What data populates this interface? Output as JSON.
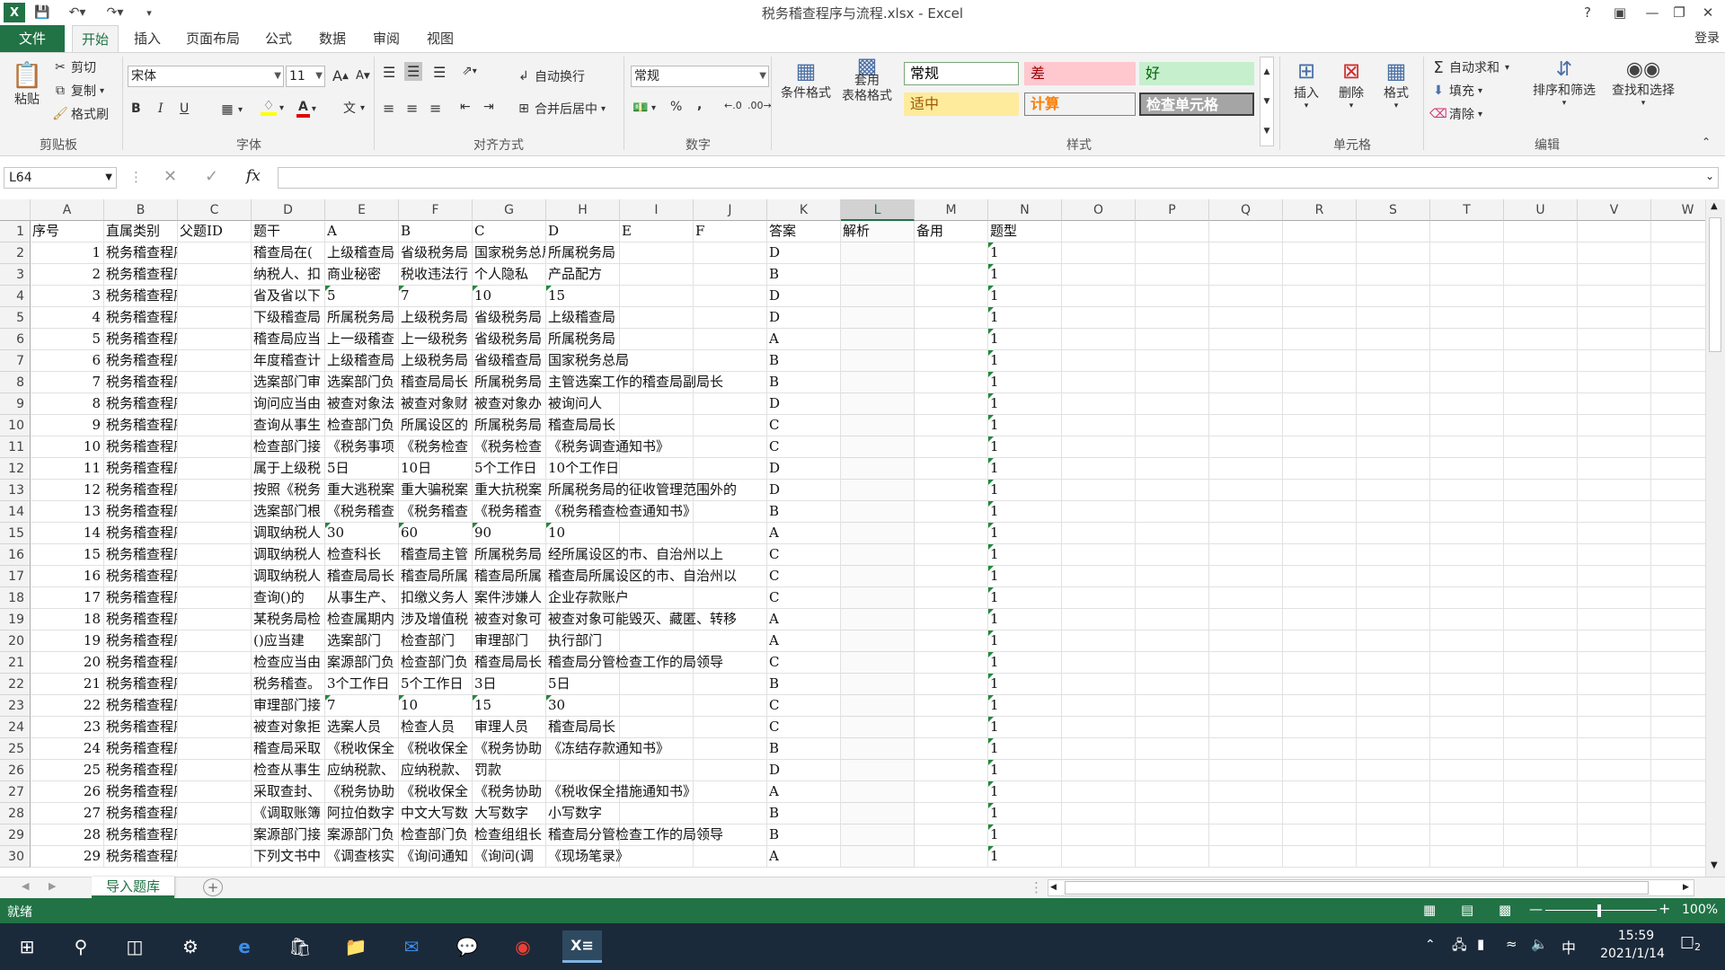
{
  "titlebar": {
    "title": "税务稽查程序与流程.xlsx - Excel",
    "app_icon": "excel-icon",
    "help": "?",
    "login": "登录"
  },
  "tabs": [
    "文件",
    "开始",
    "插入",
    "页面布局",
    "公式",
    "数据",
    "审阅",
    "视图"
  ],
  "active_tab": "开始",
  "ribbon": {
    "clipboard": {
      "paste": "粘贴",
      "cut": "剪切",
      "copy": "复制",
      "format_painter": "格式刷",
      "label": "剪贴板"
    },
    "font": {
      "name": "宋体",
      "size": "11",
      "label": "字体",
      "bold": "B",
      "italic": "I",
      "underline": "U",
      "grow": "A",
      "shrink": "A",
      "font_color": "A"
    },
    "alignment": {
      "wrap": "自动换行",
      "merge": "合并后居中",
      "label": "对齐方式"
    },
    "number": {
      "format": "常规",
      "percent": "%",
      "comma": ",",
      "label": "数字"
    },
    "styles": {
      "conditional": "条件格式",
      "table": "套用\n表格格式",
      "cells": [
        {
          "text": "常规",
          "bg": "#ffffff",
          "fg": "#000000",
          "border": "#7aa57a"
        },
        {
          "text": "差",
          "bg": "#ffc7ce",
          "fg": "#9c0006",
          "border": "#ffc7ce"
        },
        {
          "text": "好",
          "bg": "#c6efce",
          "fg": "#006100",
          "border": "#c6efce"
        },
        {
          "text": "适中",
          "bg": "#ffeb9c",
          "fg": "#9c5700",
          "border": "#ffeb9c"
        },
        {
          "text": "计算",
          "bg": "#f2f2f2",
          "fg": "#fa7d00",
          "border": "#7f7f7f"
        },
        {
          "text": "检查单元格",
          "bg": "#a5a5a5",
          "fg": "#ffffff",
          "border": "#3f3f3f"
        }
      ],
      "label": "样式"
    },
    "cells_group": {
      "insert": "插入",
      "delete": "删除",
      "format": "格式",
      "label": "单元格"
    },
    "editing": {
      "autosum": "自动求和",
      "fill": "填充",
      "clear": "清除",
      "sort": "排序和筛选",
      "find": "查找和选择",
      "label": "编辑"
    }
  },
  "formula_bar": {
    "name_box": "L64",
    "fx": "fx",
    "value": ""
  },
  "columns": [
    "A",
    "B",
    "C",
    "D",
    "E",
    "F",
    "G",
    "H",
    "I",
    "J",
    "K",
    "L",
    "M",
    "N",
    "O",
    "P",
    "Q",
    "R",
    "S",
    "T",
    "U",
    "V",
    "W"
  ],
  "selected_column": "L",
  "rows": [
    {
      "r": "1",
      "cells": {
        "A": "序号",
        "B": "直属类别",
        "C": "父题ID",
        "D": "题干",
        "E": "A",
        "F": "B",
        "G": "C",
        "H": "D",
        "I": "E",
        "J": "F",
        "K": "答案",
        "L": "解析",
        "M": "备用",
        "N": "题型"
      }
    },
    {
      "r": "2",
      "cells": {
        "A": "1",
        "B": "税务稽查程序与流程",
        "D": "稽查局在(",
        "E": "上级稽查局",
        "F": "省级税务局",
        "G": "国家税务总局",
        "H": "所属税务局",
        "K": "D",
        "N": "1"
      }
    },
    {
      "r": "3",
      "cells": {
        "A": "2",
        "B": "税务稽查程序与流程",
        "D": "纳税人、扣",
        "E": "商业秘密",
        "F": "税收违法行",
        "G": "个人隐私",
        "H": "产品配方",
        "K": "B",
        "N": "1"
      }
    },
    {
      "r": "4",
      "cells": {
        "A": "3",
        "B": "税务稽查程序与流程",
        "D": "省及省以下",
        "E": "5",
        "F": "7",
        "G": "10",
        "H": "15",
        "K": "D",
        "N": "1"
      }
    },
    {
      "r": "5",
      "cells": {
        "A": "4",
        "B": "税务稽查程序与流程",
        "D": "下级稽查局",
        "E": "所属税务局",
        "F": "上级税务局",
        "G": "省级税务局",
        "H": "上级稽查局",
        "K": "D",
        "N": "1"
      }
    },
    {
      "r": "6",
      "cells": {
        "A": "5",
        "B": "税务稽查程序与流程",
        "D": "稽查局应当",
        "E": "上一级稽查",
        "F": "上一级税务",
        "G": "省级税务局",
        "H": "所属税务局",
        "K": "A",
        "N": "1"
      }
    },
    {
      "r": "7",
      "cells": {
        "A": "6",
        "B": "税务稽查程序与流程",
        "D": "年度稽查计",
        "E": "上级稽查局",
        "F": "上级税务局",
        "G": "省级稽查局",
        "H": "国家税务总局",
        "K": "B",
        "N": "1"
      }
    },
    {
      "r": "8",
      "cells": {
        "A": "7",
        "B": "税务稽查程序与流程",
        "D": "选案部门审",
        "E": "选案部门负",
        "F": "稽查局局长",
        "G": "所属税务局",
        "H": "主管选案工作的稽查局副局长",
        "K": "B",
        "N": "1"
      }
    },
    {
      "r": "9",
      "cells": {
        "A": "8",
        "B": "税务稽查程序与流程",
        "D": "询问应当由",
        "E": "被查对象法",
        "F": "被查对象财",
        "G": "被查对象办",
        "H": "被询问人",
        "K": "D",
        "N": "1"
      }
    },
    {
      "r": "10",
      "cells": {
        "A": "9",
        "B": "税务稽查程序与流程",
        "D": "查询从事生",
        "E": "检查部门负",
        "F": "所属设区的",
        "G": "所属税务局",
        "H": "稽查局局长",
        "K": "C",
        "N": "1"
      }
    },
    {
      "r": "11",
      "cells": {
        "A": "10",
        "B": "税务稽查程序与流程",
        "D": "检查部门接",
        "E": "《税务事项",
        "F": "《税务检查",
        "G": "《税务检查",
        "H": "《税务调查通知书》",
        "K": "C",
        "N": "1"
      }
    },
    {
      "r": "12",
      "cells": {
        "A": "11",
        "B": "税务稽查程序与流程",
        "D": "属于上级税",
        "E": "5日",
        "F": "10日",
        "G": "5个工作日",
        "H": "10个工作日",
        "K": "D",
        "N": "1"
      }
    },
    {
      "r": "13",
      "cells": {
        "A": "12",
        "B": "税务稽查程序与流程",
        "D": "按照《税务",
        "E": "重大逃税案",
        "F": "重大骗税案",
        "G": "重大抗税案",
        "H": "所属税务局的征收管理范围外的",
        "K": "D",
        "N": "1"
      }
    },
    {
      "r": "14",
      "cells": {
        "A": "13",
        "B": "税务稽查程序与流程",
        "D": "选案部门根",
        "E": "《税务稽查",
        "F": "《税务稽查",
        "G": "《税务稽查",
        "H": "《税务稽查检查通知书》",
        "K": "B",
        "N": "1"
      }
    },
    {
      "r": "15",
      "cells": {
        "A": "14",
        "B": "税务稽查程序与流程",
        "D": "调取纳税人",
        "E": "30",
        "F": "60",
        "G": "90",
        "H": "10",
        "K": "A",
        "N": "1"
      }
    },
    {
      "r": "16",
      "cells": {
        "A": "15",
        "B": "税务稽查程序与流程",
        "D": "调取纳税人",
        "E": "检查科长",
        "F": "稽查局主管",
        "G": "所属税务局",
        "H": "经所属设区的市、自治州以上",
        "K": "C",
        "N": "1"
      }
    },
    {
      "r": "17",
      "cells": {
        "A": "16",
        "B": "税务稽查程序与流程",
        "D": "调取纳税人",
        "E": "稽查局局长",
        "F": "稽查局所属",
        "G": "稽查局所属",
        "H": "稽查局所属设区的市、自治州以",
        "K": "C",
        "N": "1"
      }
    },
    {
      "r": "18",
      "cells": {
        "A": "17",
        "B": "税务稽查程序与流程",
        "D": "查询()的",
        "E": "从事生产、",
        "F": "扣缴义务人",
        "G": "案件涉嫌人",
        "H": "企业存款账户",
        "K": "C",
        "N": "1"
      }
    },
    {
      "r": "19",
      "cells": {
        "A": "18",
        "B": "税务稽查程序与流程",
        "D": "某税务局检",
        "E": "检查属期内",
        "F": "涉及增值税",
        "G": "被查对象可",
        "H": "被查对象可能毁灭、藏匿、转移",
        "K": "A",
        "N": "1"
      }
    },
    {
      "r": "20",
      "cells": {
        "A": "19",
        "B": "税务稽查程序与流程",
        "D": "()应当建",
        "E": "选案部门",
        "F": "检查部门",
        "G": "审理部门",
        "H": "执行部门",
        "K": "A",
        "N": "1"
      }
    },
    {
      "r": "21",
      "cells": {
        "A": "20",
        "B": "税务稽查程序与流程",
        "D": "检查应当由",
        "E": "案源部门负",
        "F": "检查部门负",
        "G": "稽查局局长",
        "H": "稽查局分管检查工作的局领导",
        "K": "C",
        "N": "1"
      }
    },
    {
      "r": "22",
      "cells": {
        "A": "21",
        "B": "税务稽查程序与流程",
        "D": "税务稽查。",
        "E": "3个工作日",
        "F": "5个工作日",
        "G": "3日",
        "H": "5日",
        "K": "B",
        "N": "1"
      }
    },
    {
      "r": "23",
      "cells": {
        "A": "22",
        "B": "税务稽查程序与流程",
        "D": "审理部门接",
        "E": "7",
        "F": "10",
        "G": "15",
        "H": "30",
        "K": "C",
        "N": "1"
      }
    },
    {
      "r": "24",
      "cells": {
        "A": "23",
        "B": "税务稽查程序与流程",
        "D": "被查对象拒",
        "E": "选案人员",
        "F": "检查人员",
        "G": "审理人员",
        "H": "稽查局局长",
        "K": "C",
        "N": "1"
      }
    },
    {
      "r": "25",
      "cells": {
        "A": "24",
        "B": "税务稽查程序与流程",
        "D": "稽查局采取",
        "E": "《税收保全",
        "F": "《税收保全",
        "G": "《税务协助",
        "H": "《冻结存款通知书》",
        "K": "B",
        "N": "1"
      }
    },
    {
      "r": "26",
      "cells": {
        "A": "25",
        "B": "税务稽查程序与流程",
        "D": "检查从事生",
        "E": "应纳税款、",
        "F": "应纳税款、",
        "G": "罚款",
        "K": "D",
        "N": "1"
      }
    },
    {
      "r": "27",
      "cells": {
        "A": "26",
        "B": "税务稽查程序与流程",
        "D": "采取查封、",
        "E": "《税务协助",
        "F": "《税收保全",
        "G": "《税务协助",
        "H": "《税收保全措施通知书》",
        "K": "A",
        "N": "1"
      }
    },
    {
      "r": "28",
      "cells": {
        "A": "27",
        "B": "税务稽查程序与流程",
        "D": "《调取账簿",
        "E": "阿拉伯数字",
        "F": "中文大写数",
        "G": "大写数字",
        "H": "小写数字",
        "K": "B",
        "N": "1"
      }
    },
    {
      "r": "29",
      "cells": {
        "A": "28",
        "B": "税务稽查程序与流程",
        "D": "案源部门接",
        "E": "案源部门负",
        "F": "检查部门负",
        "G": "检查组组长",
        "H": "稽查局分管检查工作的局领导",
        "K": "B",
        "N": "1"
      }
    },
    {
      "r": "30",
      "cells": {
        "A": "29",
        "B": "税务稽查程序与流程",
        "D": "下列文书中",
        "E": "《调查核实",
        "F": "《询问通知",
        "G": "《询问(调",
        "H": "《现场笔录》",
        "K": "A",
        "N": "1"
      }
    }
  ],
  "sheet_tabs": [
    "导入题库"
  ],
  "status": {
    "ready": "就绪",
    "zoom": "100%"
  },
  "taskbar": {
    "time": "15:59",
    "date": "2021/1/14",
    "ime": "中",
    "notifications": "2"
  }
}
